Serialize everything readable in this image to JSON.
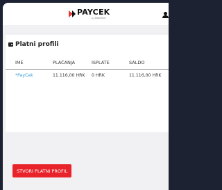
{
  "header": {
    "logo_text": "PAYCEK",
    "logo_subtext": "by INNOTECH",
    "user_icon": "user-icon"
  },
  "profiles": {
    "title": "Platni profili",
    "title_icon": "wallet-icon",
    "columns": [
      "IME",
      "PLAĆANJA",
      "ISPLATE",
      "SALDO"
    ],
    "rows": [
      {
        "name": "*PayCek",
        "payments": "11.116,00 HRK",
        "payouts": "0 HRK",
        "balance": "11.116,00 HRK"
      }
    ]
  },
  "actions": {
    "create_label": "STVORI PLATNI PROFIL"
  },
  "colors": {
    "accent": "#e8242a",
    "link": "#3a9bd9",
    "frame": "#1d2233",
    "background": "#f1f1f3"
  }
}
